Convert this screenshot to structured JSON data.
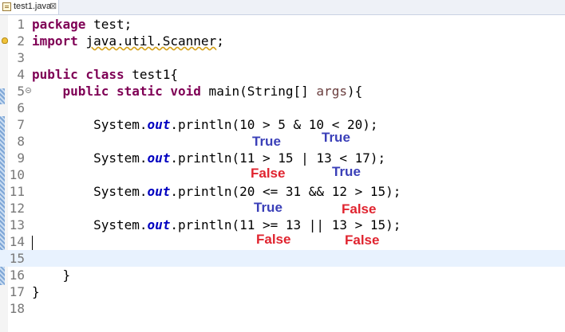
{
  "tab": {
    "title": "test1.java",
    "close": "⊠"
  },
  "lines": [
    {
      "n": "1"
    },
    {
      "n": "2"
    },
    {
      "n": "3"
    },
    {
      "n": "4"
    },
    {
      "n": "5"
    },
    {
      "n": "6"
    },
    {
      "n": "7"
    },
    {
      "n": "8"
    },
    {
      "n": "9"
    },
    {
      "n": "10"
    },
    {
      "n": "11"
    },
    {
      "n": "12"
    },
    {
      "n": "13"
    },
    {
      "n": "14"
    },
    {
      "n": "15"
    },
    {
      "n": "16"
    },
    {
      "n": "17"
    },
    {
      "n": "18"
    }
  ],
  "code": {
    "l1_kw": "package",
    "l1_rest": " test;",
    "l2_kw": "import",
    "l2_pkg": "java.util.Scanner",
    "l2_end": ";",
    "l4_kw": "public class",
    "l4_rest": " test1{",
    "l5_kw": "public static void",
    "l5_rest": " main(String[] ",
    "l5_param": "args",
    "l5_end": "){",
    "l7_a": "System.",
    "l7_out": "out",
    "l7_b": ".println(10 > 5 & 10 < 20);",
    "l9_a": "System.",
    "l9_out": "out",
    "l9_b": ".println(11 > 15 | 13 < 17);",
    "l11_a": "System.",
    "l11_out": "out",
    "l11_b": ".println(20 <= 31 && 12 > 15);",
    "l13_a": "System.",
    "l13_out": "out",
    "l13_b": ".println(11 >= 13 || 13 > 15);",
    "l16": "}",
    "l17": "}"
  },
  "annotations": {
    "a1": "True",
    "a2": "True",
    "a3": "False",
    "a4": "True",
    "a5": "True",
    "a6": "False",
    "a7": "False",
    "a8": "False"
  },
  "colors": {
    "true_label": "#3a3fb8",
    "false_label": "#e0242f",
    "keyword": "#7f0055",
    "field": "#0000c0"
  }
}
